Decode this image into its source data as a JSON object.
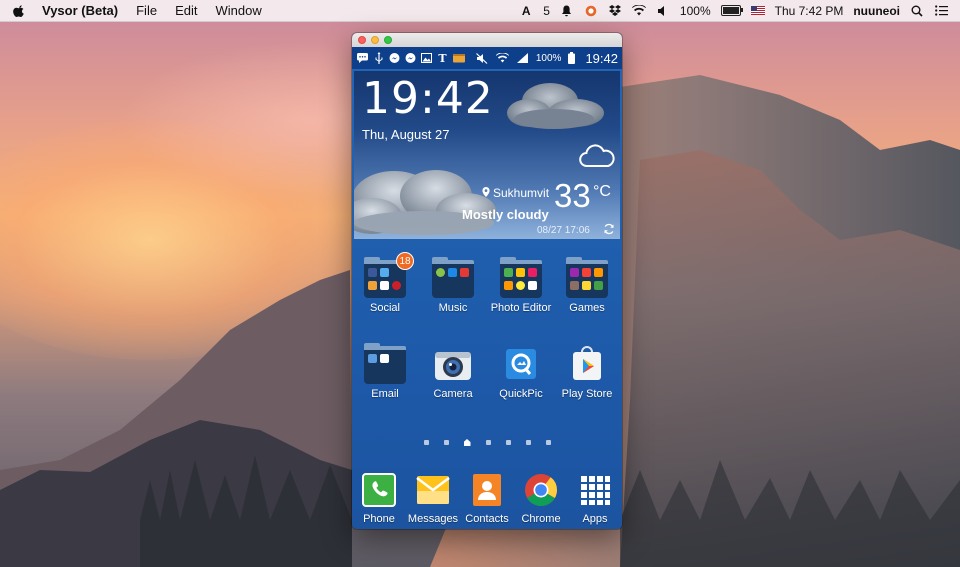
{
  "menubar": {
    "app_name": "Vysor (Beta)",
    "menus": [
      "File",
      "Edit",
      "Window"
    ],
    "status": {
      "notification_count": "5",
      "battery_percent": "100%",
      "clock": "Thu 7:42 PM",
      "user": "nuuneoi"
    },
    "icons": [
      "apple-icon",
      "adobe-icon",
      "bell-icon",
      "hangouts-icon",
      "wifi-icon",
      "volume-icon",
      "battery-icon",
      "us-flag-icon",
      "spotlight-icon",
      "notification-center-icon"
    ]
  },
  "phone": {
    "statusbar": {
      "left_icons": [
        "message-icon",
        "usb-icon",
        "messenger-icon",
        "messenger-icon",
        "gallery-icon",
        "nytimes-icon",
        "package-icon"
      ],
      "right_icons": [
        "mute-icon",
        "wifi-icon",
        "signal-icon"
      ],
      "battery": "100%",
      "time": "19:42"
    },
    "weather": {
      "time": "19:42",
      "date": "Thu, August 27",
      "location": "Sukhumvit",
      "condition": "Mostly cloudy",
      "temperature": "33",
      "unit": "°C",
      "updated": "08/27 17:06"
    },
    "apps_row1": [
      {
        "label": "Social",
        "badge": "18"
      },
      {
        "label": "Music"
      },
      {
        "label": "Photo Editor"
      },
      {
        "label": "Games"
      }
    ],
    "apps_row2": [
      {
        "label": "Email"
      },
      {
        "label": "Camera"
      },
      {
        "label": "QuickPic"
      },
      {
        "label": "Play Store"
      }
    ],
    "dock": [
      {
        "label": "Phone"
      },
      {
        "label": "Messages"
      },
      {
        "label": "Contacts"
      },
      {
        "label": "Chrome"
      },
      {
        "label": "Apps"
      }
    ]
  },
  "colors": {
    "phone_bg": "#1f5fae",
    "statusbar": "#0e3f8a",
    "badge": "#f06a22"
  }
}
